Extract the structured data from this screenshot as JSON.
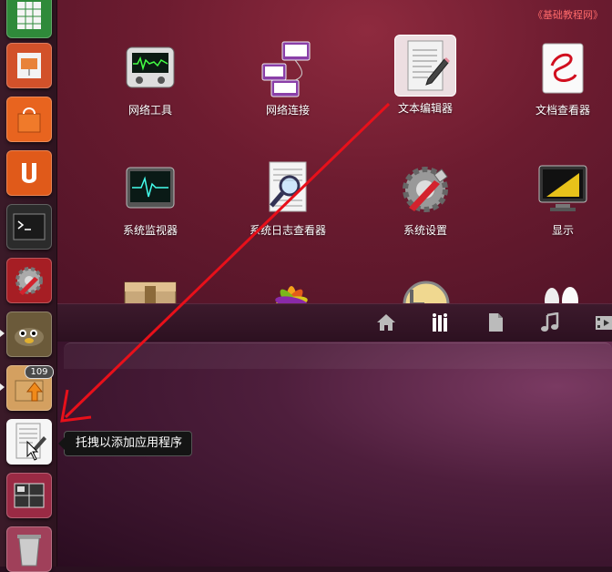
{
  "watermark": "《基础教程网》",
  "launcher": {
    "badge_count": "109"
  },
  "apps": [
    {
      "label": "网络工具",
      "icon": "network-tools-icon"
    },
    {
      "label": "网络连接",
      "icon": "network-connections-icon"
    },
    {
      "label": "文本编辑器",
      "icon": "text-editor-icon",
      "selected": true
    },
    {
      "label": "文档查看器",
      "icon": "document-viewer-icon"
    },
    {
      "label": "系统监视器",
      "icon": "system-monitor-icon"
    },
    {
      "label": "系统日志查看器",
      "icon": "log-viewer-icon"
    },
    {
      "label": "系统设置",
      "icon": "system-settings-icon"
    },
    {
      "label": "显示",
      "icon": "display-icon"
    }
  ],
  "lenses": [
    "home-lens-icon",
    "applications-lens-icon",
    "files-lens-icon",
    "music-lens-icon",
    "video-lens-icon"
  ],
  "tooltip": "托拽以添加应用程序",
  "colors": {
    "arrow": "#e8101a",
    "dash_bg": "#6d1c30"
  }
}
